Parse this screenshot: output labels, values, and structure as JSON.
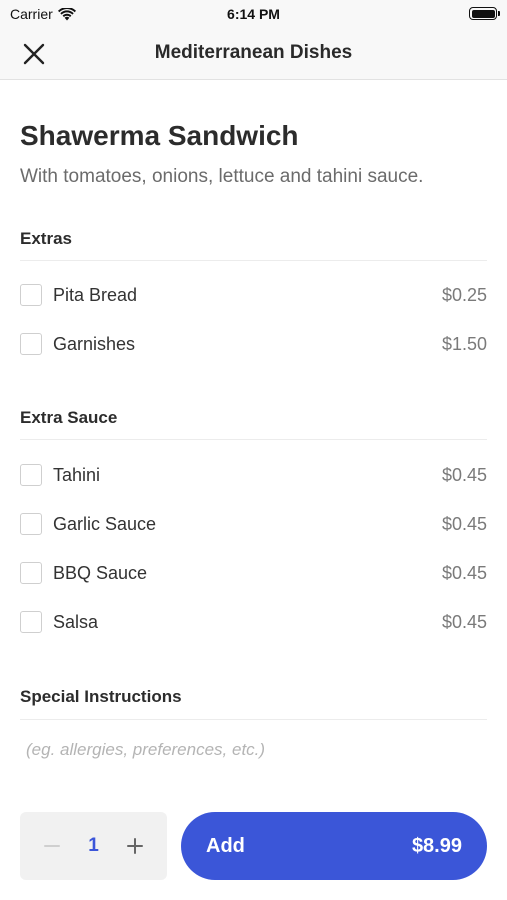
{
  "status_bar": {
    "carrier": "Carrier",
    "time": "6:14 PM"
  },
  "nav": {
    "title": "Mediterranean Dishes",
    "close_icon": "close-icon"
  },
  "dish": {
    "title": "Shawerma Sandwich",
    "description": "With tomatoes, onions, lettuce and tahini sauce."
  },
  "extras": {
    "title": "Extras",
    "items": [
      {
        "label": "Pita Bread",
        "price": "$0.25",
        "checked": false
      },
      {
        "label": "Garnishes",
        "price": "$1.50",
        "checked": false
      }
    ]
  },
  "extra_sauce": {
    "title": "Extra Sauce",
    "items": [
      {
        "label": "Tahini",
        "price": "$0.45",
        "checked": false
      },
      {
        "label": "Garlic Sauce",
        "price": "$0.45",
        "checked": false
      },
      {
        "label": "BBQ Sauce",
        "price": "$0.45",
        "checked": false
      },
      {
        "label": "Salsa",
        "price": "$0.45",
        "checked": false
      }
    ]
  },
  "special_instructions": {
    "title": "Special Instructions",
    "placeholder": "(eg. allergies, preferences, etc.)",
    "value": ""
  },
  "quantity": {
    "value": "1"
  },
  "add_button": {
    "label": "Add",
    "price": "$8.99"
  },
  "colors": {
    "accent": "#3b56d8",
    "stepper_bg": "#f1f1f1",
    "nav_bg": "#f8f8f8"
  }
}
